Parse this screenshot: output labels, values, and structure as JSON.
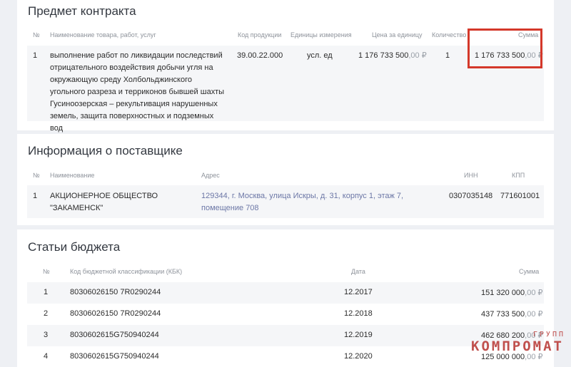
{
  "contract": {
    "title": "Предмет контракта",
    "headers": {
      "num": "№",
      "name": "Наименование товара, работ, услуг",
      "code": "Код продукции",
      "unit": "Единицы измерения",
      "price": "Цена за единицу",
      "qty": "Количество",
      "sum": "Сумма"
    },
    "row": {
      "num": "1",
      "name": "выполнение работ по ликвидации последствий отрицательного воздействия добычи угля на окружающую среду Холбольджинского угольного разреза и терриконов бывшей шахты Гусиноозерская – рекультивация нарушенных земель, защита поверхностных и подземных вод",
      "code": "39.00.22.000",
      "unit": "усл. ед",
      "price_main": "1 176 733 500",
      "price_kop": ",00 ₽",
      "qty": "1",
      "sum_main": "1 176 733 500",
      "sum_kop": ",00 ₽"
    }
  },
  "supplier": {
    "title": "Информация о поставщике",
    "headers": {
      "num": "№",
      "name": "Наименование",
      "address": "Адрес",
      "inn": "ИНН",
      "kpp": "КПП"
    },
    "row": {
      "num": "1",
      "name": "АКЦИОНЕРНОЕ ОБЩЕСТВО \"ЗАКАМЕНСК\"",
      "address": "129344, г. Москва, улица Искры, д. 31, корпус 1, этаж 7, помещение 708",
      "inn": "0307035148",
      "kpp": "771601001"
    }
  },
  "budget": {
    "title": "Статьи бюджета",
    "headers": {
      "num": "№",
      "kbk": "Код бюджетной классификации (КБК)",
      "date": "Дата",
      "sum": "Сумма"
    },
    "rows": [
      {
        "num": "1",
        "kbk": "80306026150 7R0290244",
        "date": "12.2017",
        "sum_main": "151 320 000",
        "sum_kop": ",00 ₽"
      },
      {
        "num": "2",
        "kbk": "80306026150 7R0290244",
        "date": "12.2018",
        "sum_main": "437 733 500",
        "sum_kop": ",00 ₽"
      },
      {
        "num": "3",
        "kbk": "8030602615G750940244",
        "date": "12.2019",
        "sum_main": "462 680 200",
        "sum_kop": ",00 ₽"
      },
      {
        "num": "4",
        "kbk": "8030602615G750940244",
        "date": "12.2020",
        "sum_main": "125 000 000",
        "sum_kop": ",00 ₽"
      }
    ]
  },
  "watermark": {
    "main": "КОМПРОМАТ",
    "small": "ГРУПП"
  },
  "colors": {
    "highlight": "#d4382a",
    "link": "#6c77a6",
    "watermark": "#c0504d"
  }
}
